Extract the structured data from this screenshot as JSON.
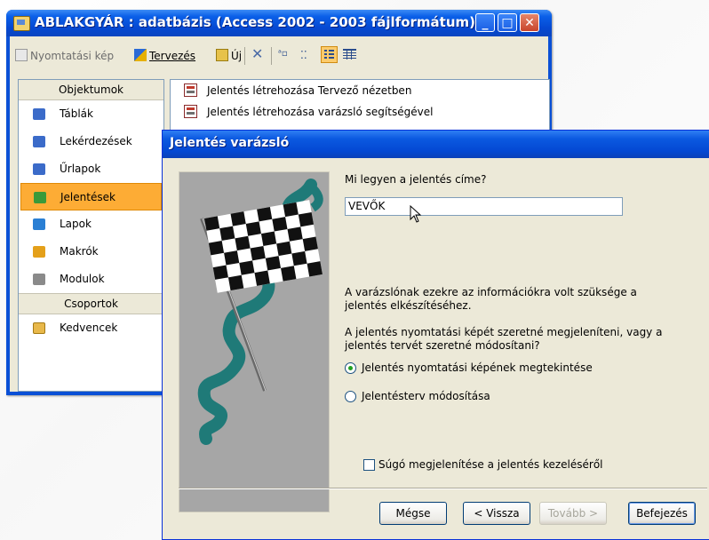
{
  "window": {
    "title": "ABLAKGYÁR : adatbázis (Access 2002 - 2003 fájlformátum)",
    "controls": {
      "minimize": "_",
      "maximize": "□",
      "close": "✕"
    }
  },
  "toolbar": {
    "preview_label": "Nyomtatási kép",
    "design_label": "Tervezés",
    "new_label": "Új",
    "delete_icon": "✕",
    "large_icons_glyph": "ᵃ▫",
    "small_icons_glyph": "⁚⁚"
  },
  "objects": {
    "header": "Objektumok",
    "items": [
      {
        "label": "Táblák",
        "icon": "table-icon",
        "color": "#3b6bc9"
      },
      {
        "label": "Lekérdezések",
        "icon": "query-icon",
        "color": "#3b6bc9"
      },
      {
        "label": "Űrlapok",
        "icon": "form-icon",
        "color": "#3b6bc9"
      },
      {
        "label": "Jelentések",
        "icon": "report-icon",
        "color": "#3a9a3a",
        "selected": true
      },
      {
        "label": "Lapok",
        "icon": "page-icon",
        "color": "#2a7fd4"
      },
      {
        "label": "Makrók",
        "icon": "macro-icon",
        "color": "#e4a01a"
      },
      {
        "label": "Modulok",
        "icon": "module-icon",
        "color": "#8a8a8a"
      }
    ],
    "groups_header": "Csoportok",
    "favorites": "Kedvencek"
  },
  "list": {
    "items": [
      "Jelentés létrehozása Tervező nézetben",
      "Jelentés létrehozása varázsló segítségével"
    ]
  },
  "wizard": {
    "title": "Jelentés varázsló",
    "question": "Mi legyen a jelentés címe?",
    "title_value": "VEVŐK",
    "info_line1": "A varázslónak ezekre az információkra volt szüksége a",
    "info_line2": "jelentés elkészítéséhez.",
    "info2_line1": "A jelentés nyomtatási képét szeretné megjeleníteni, vagy a",
    "info2_line2": "jelentés tervét szeretné módosítani?",
    "option1": "Jelentés nyomtatási képének megtekintése",
    "option2": "Jelentésterv módosítása",
    "option1_selected": true,
    "help_checkbox": "Súgó megjelenítése a jelentés kezeléséről",
    "buttons": {
      "cancel": "Mégse",
      "back": "< Vissza",
      "next": "Tovább >",
      "finish": "Befejezés"
    }
  }
}
